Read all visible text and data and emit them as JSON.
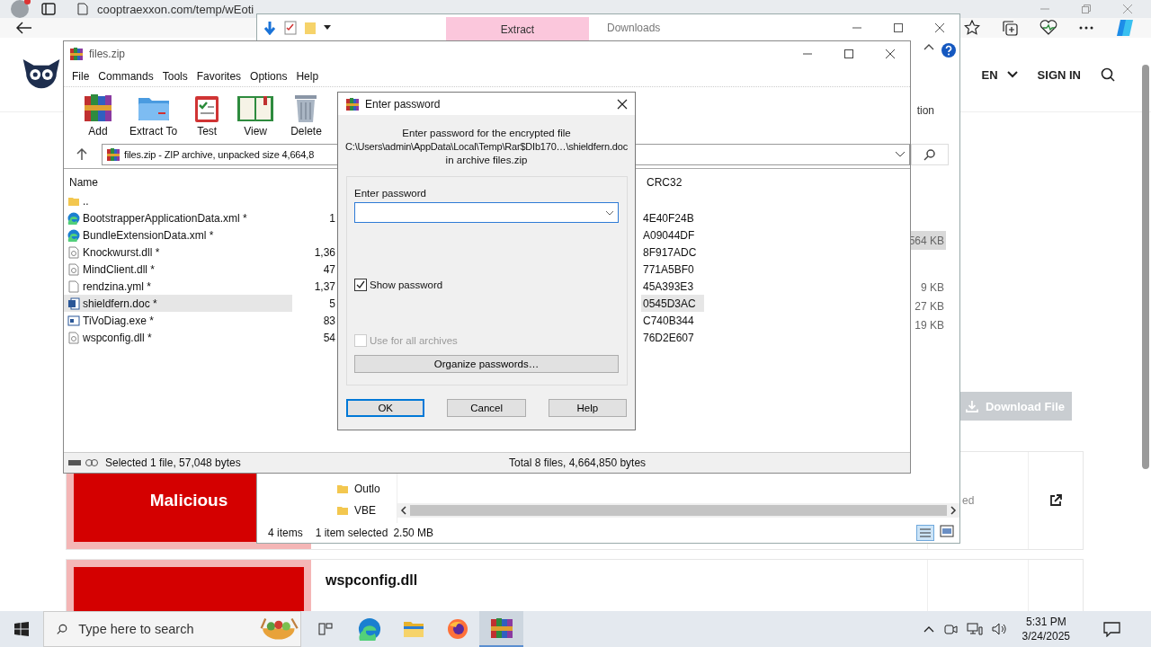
{
  "browser": {
    "tab": {
      "title": "cooptraexxon.com/temp/wEoti"
    },
    "header": {
      "language": "EN",
      "sign_in": "SIGN IN"
    },
    "download_button": "Download File",
    "cards": [
      {
        "verdict": "Malicious",
        "status": "ed"
      },
      {
        "name": "wspconfig.dll"
      }
    ]
  },
  "explorer": {
    "title": "Downloads",
    "ribbon_tab": "Extract",
    "ribbon_label": "tion",
    "sizes": [
      {
        "text": "564 KB",
        "selected": true
      },
      {
        "text": "9 KB",
        "selected": false
      },
      {
        "text": "27 KB",
        "selected": false
      },
      {
        "text": "19 KB",
        "selected": false
      }
    ],
    "folders": [
      "Outlo",
      "VBE"
    ],
    "status": {
      "items": "4 items",
      "selection": "1 item selected",
      "size": "2.50 MB"
    }
  },
  "winrar": {
    "title": "files.zip",
    "menu": [
      "File",
      "Commands",
      "Tools",
      "Favorites",
      "Options",
      "Help"
    ],
    "toolbar": [
      {
        "label": "Add",
        "kind": "books"
      },
      {
        "label": "Extract To",
        "kind": "folder"
      },
      {
        "label": "Test",
        "kind": "clipboard"
      },
      {
        "label": "View",
        "kind": "book"
      },
      {
        "label": "Delete",
        "kind": "trash"
      }
    ],
    "address": "files.zip - ZIP archive, unpacked size 4,664,8",
    "columns": {
      "name": "Name",
      "crc": "CRC32"
    },
    "rows": [
      {
        "name": "..",
        "kind": "folder",
        "selected": false
      },
      {
        "name": "BootstrapperApplicationData.xml *",
        "size": "1",
        "crc": "4E40F24B",
        "kind": "edge",
        "selected": false
      },
      {
        "name": "BundleExtensionData.xml *",
        "crc": "A09044DF",
        "kind": "edge",
        "selected": false
      },
      {
        "name": "Knockwurst.dll *",
        "size": "1,36",
        "crc": "8F917ADC",
        "kind": "dll",
        "selected": false
      },
      {
        "name": "MindClient.dll *",
        "size": "47",
        "crc": "771A5BF0",
        "kind": "dll",
        "selected": false
      },
      {
        "name": "rendzina.yml *",
        "size": "1,37",
        "crc": "45A393E3",
        "kind": "text",
        "selected": false
      },
      {
        "name": "shieldfern.doc *",
        "size": "5",
        "crc": "0545D3AC",
        "kind": "word",
        "selected": true
      },
      {
        "name": "TiVoDiag.exe *",
        "size": "83",
        "crc": "C740B344",
        "kind": "exe",
        "selected": false
      },
      {
        "name": "wspconfig.dll *",
        "size": "54",
        "crc": "76D2E607",
        "kind": "dll",
        "selected": false
      }
    ],
    "status": {
      "selected": "Selected 1 file, 57,048 bytes",
      "total": "Total 8 files, 4,664,850 bytes"
    }
  },
  "dialog": {
    "title": "Enter password",
    "message": [
      "Enter password for the encrypted file",
      "C:\\Users\\admin\\AppData\\Local\\Temp\\Rar$DIb170…\\shieldfern.doc",
      "in archive files.zip"
    ],
    "field_label": "Enter password",
    "show_password": {
      "label": "Show password",
      "checked": true,
      "disabled": false
    },
    "use_for_all": {
      "label": "Use for all archives",
      "checked": false,
      "disabled": true
    },
    "organize": "Organize passwords…",
    "buttons": [
      {
        "label": "OK",
        "default": true
      },
      {
        "label": "Cancel",
        "default": false
      },
      {
        "label": "Help",
        "default": false
      }
    ]
  },
  "taskbar": {
    "search_placeholder": "Type here to search",
    "apps": [
      {
        "kind": "taskview",
        "active": false
      },
      {
        "kind": "edge",
        "active": false
      },
      {
        "kind": "explorer",
        "active": false
      },
      {
        "kind": "firefox",
        "active": false
      },
      {
        "kind": "winrar",
        "active": true
      }
    ],
    "time": "5:31 PM",
    "date": "3/24/2025"
  }
}
